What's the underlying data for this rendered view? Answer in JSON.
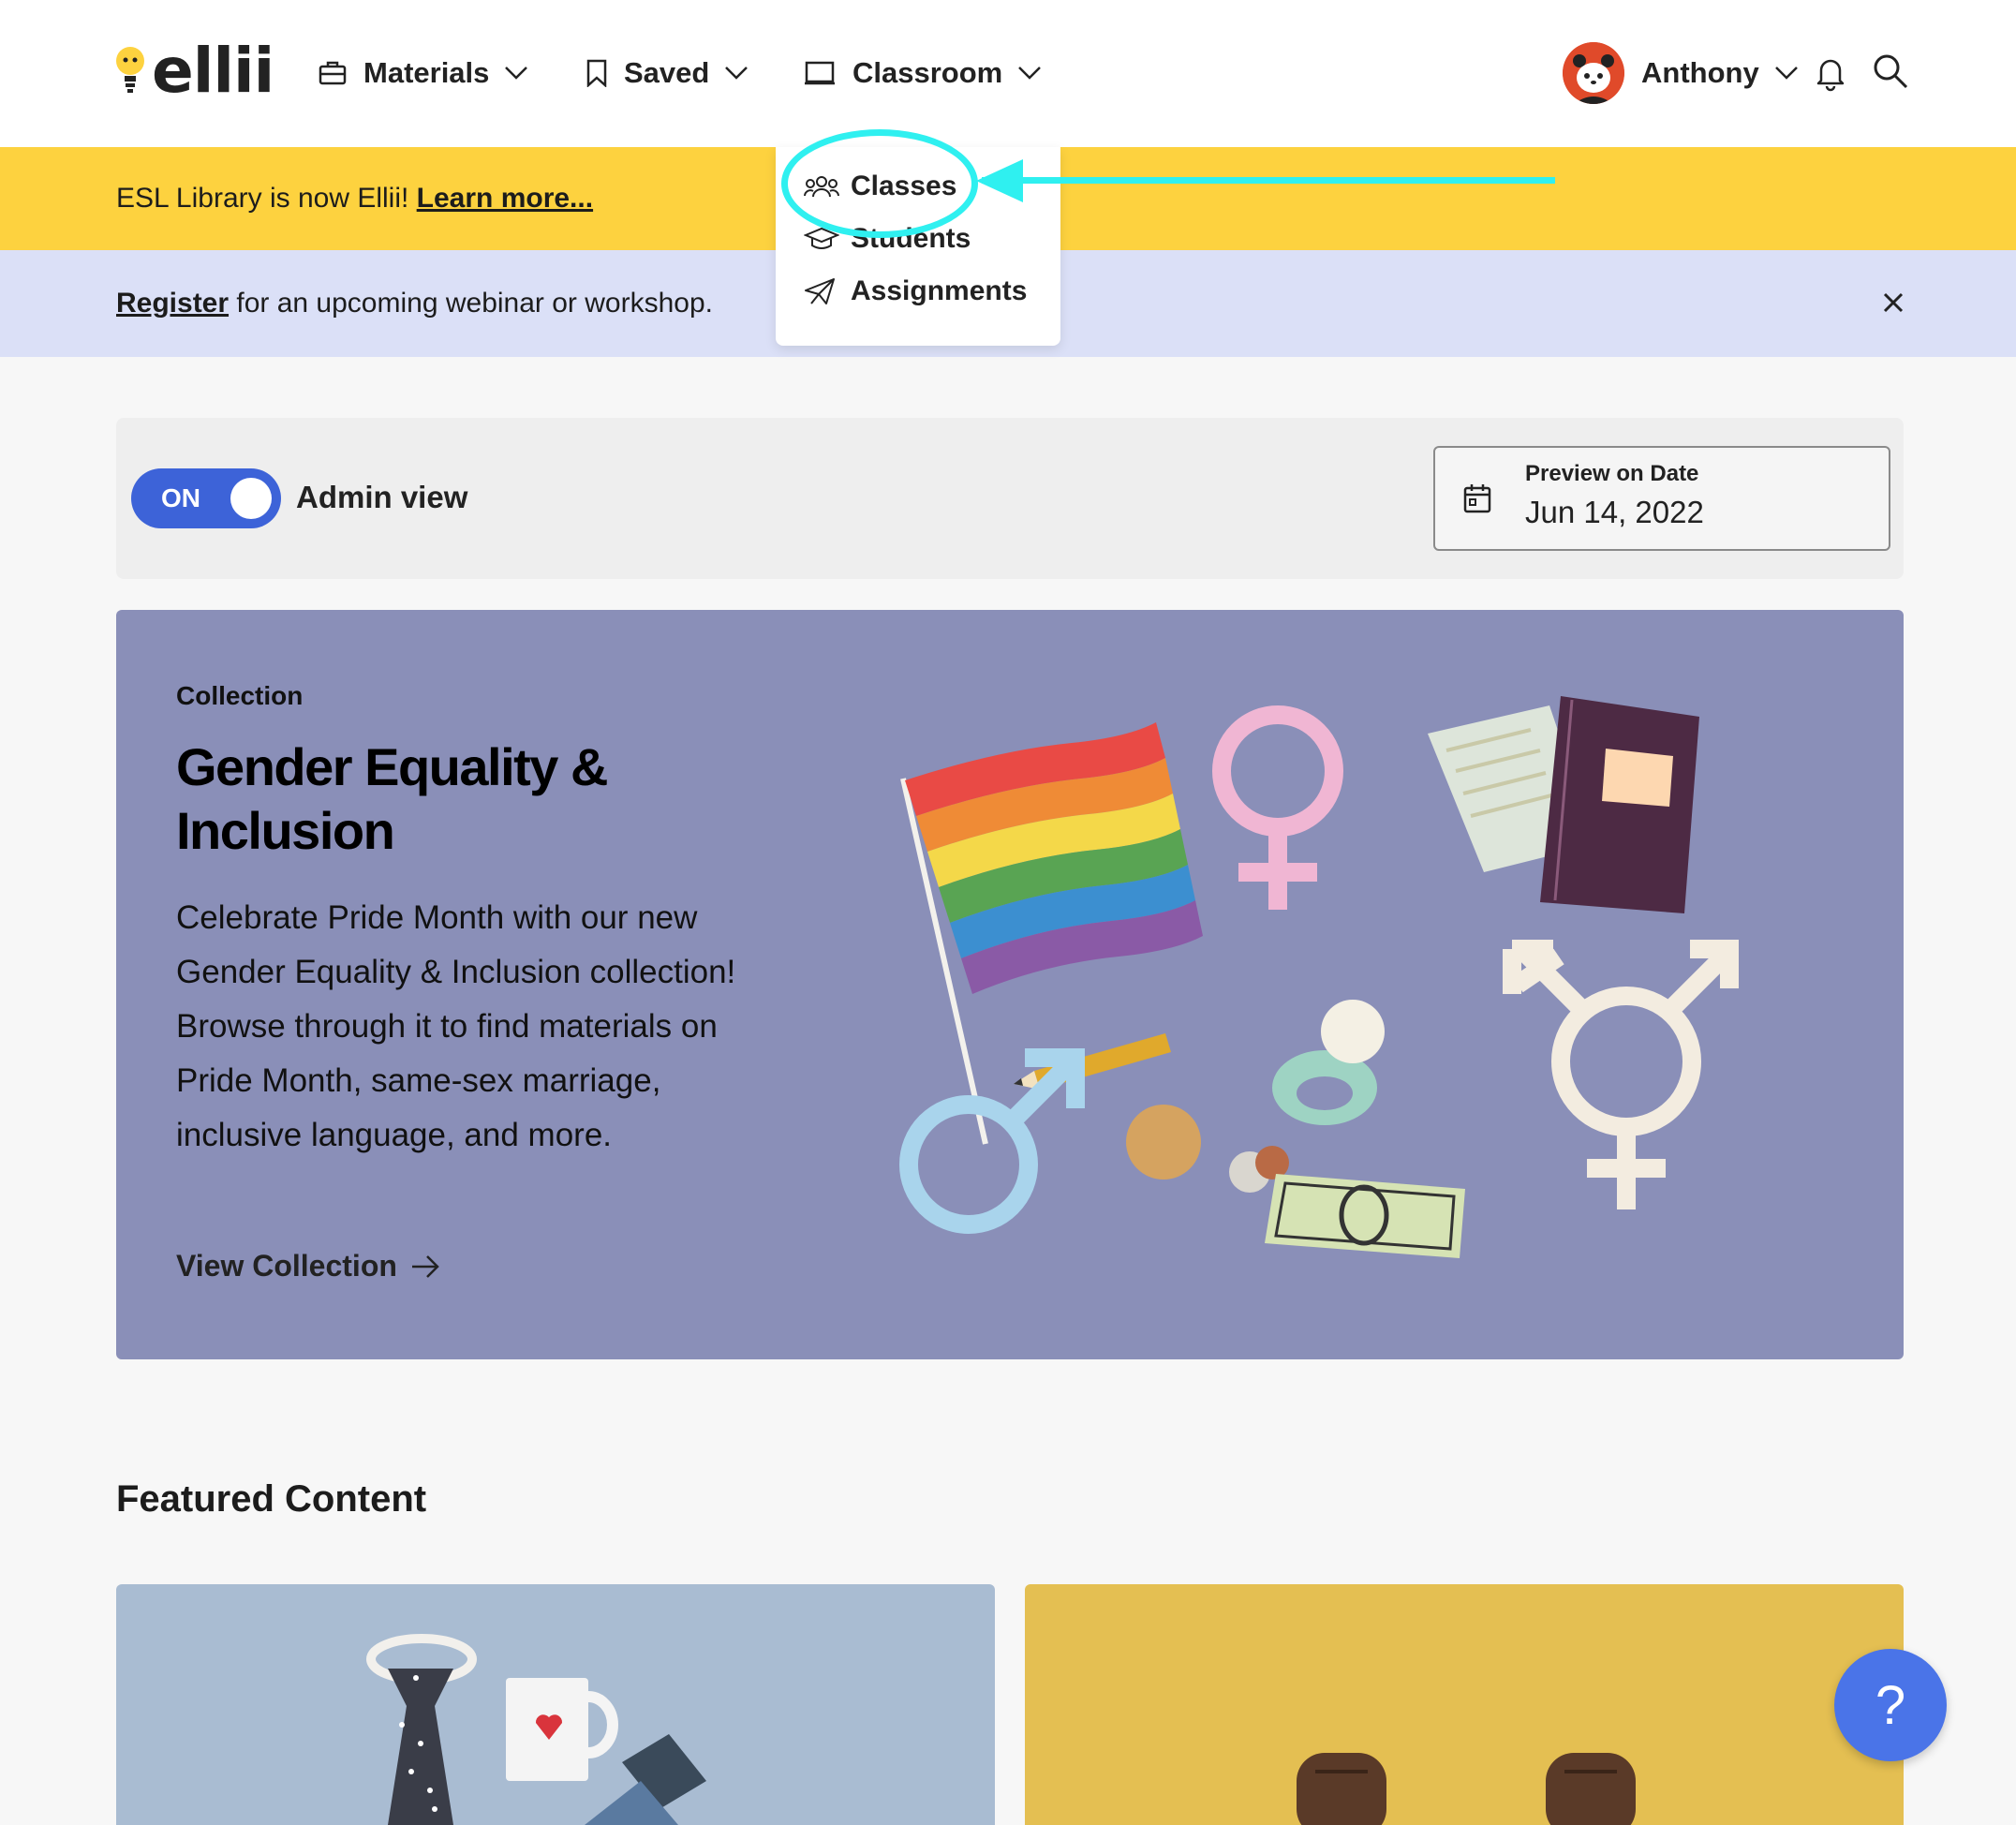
{
  "header": {
    "logo_text": "ellii",
    "nav": {
      "materials": "Materials",
      "saved": "Saved",
      "classroom": "Classroom"
    },
    "user_name": "Anthony"
  },
  "banners": {
    "rename_text": "ESL Library is now Ellii! ",
    "rename_link": "Learn more...",
    "register_link": "Register",
    "register_text": " for an upcoming webinar or workshop."
  },
  "classroom_menu": {
    "items": [
      {
        "label": "Classes",
        "icon": "people-icon"
      },
      {
        "label": "Students",
        "icon": "graduation-cap-icon"
      },
      {
        "label": "Assignments",
        "icon": "paper-plane-icon"
      }
    ]
  },
  "admin": {
    "toggle_label": "ON",
    "view_label": "Admin view",
    "preview_label": "Preview on Date",
    "preview_date": "Jun 14, 2022"
  },
  "hero": {
    "kicker": "Collection",
    "title": "Gender Equality & Inclusion",
    "description": "Celebrate Pride Month with our new Gender Equality & Inclusion collection! Browse through it to find materials on Pride Month, same-sex marriage, inclusive language, and more.",
    "cta": "View Collection"
  },
  "featured": {
    "title": "Featured Content"
  },
  "help": {
    "label": "?"
  },
  "colors": {
    "yellow_banner": "#fdd23f",
    "purple_banner": "#dbe0f7",
    "toggle_blue": "#3d63d8",
    "hero_bg": "#8a8fb8",
    "highlight": "#2ff0f0"
  }
}
